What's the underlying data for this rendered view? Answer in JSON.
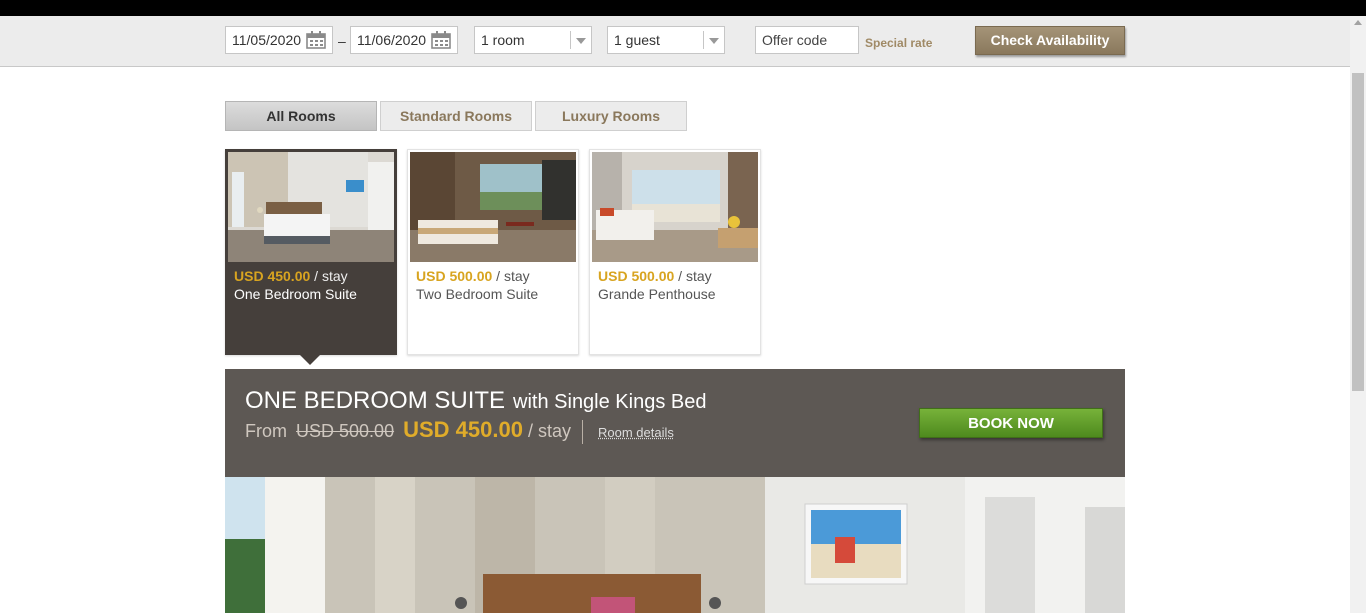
{
  "search": {
    "checkin": "11/05/2020",
    "checkout": "11/06/2020",
    "date_separator": "–",
    "rooms": "1 room",
    "guests": "1 guest",
    "offer_placeholder": "Offer code",
    "special_rate": "Special rate",
    "check_button": "Check Availability"
  },
  "tabs": [
    {
      "label": "All Rooms",
      "active": true
    },
    {
      "label": "Standard Rooms",
      "active": false
    },
    {
      "label": "Luxury Rooms",
      "active": false
    }
  ],
  "rooms": [
    {
      "price": "USD 450.00",
      "unit": "/ stay",
      "name": "One Bedroom Suite",
      "selected": true
    },
    {
      "price": "USD 500.00",
      "unit": "/ stay",
      "name": "Two Bedroom Suite",
      "selected": false
    },
    {
      "price": "USD 500.00",
      "unit": "/ stay",
      "name": "Grande Penthouse",
      "selected": false
    }
  ],
  "detail": {
    "title": "ONE BEDROOM SUITE",
    "subtitle": "with Single Kings Bed",
    "from_label": "From",
    "old_price": "USD 500.00",
    "price": "USD 450.00",
    "unit": "/ stay",
    "room_details_link": "Room details",
    "book_button": "BOOK NOW"
  },
  "colors": {
    "brand_gold": "#a08a66",
    "price_gold": "#d8a420",
    "book_green": "#5f9a2a",
    "dark_panel": "#453f3b"
  }
}
